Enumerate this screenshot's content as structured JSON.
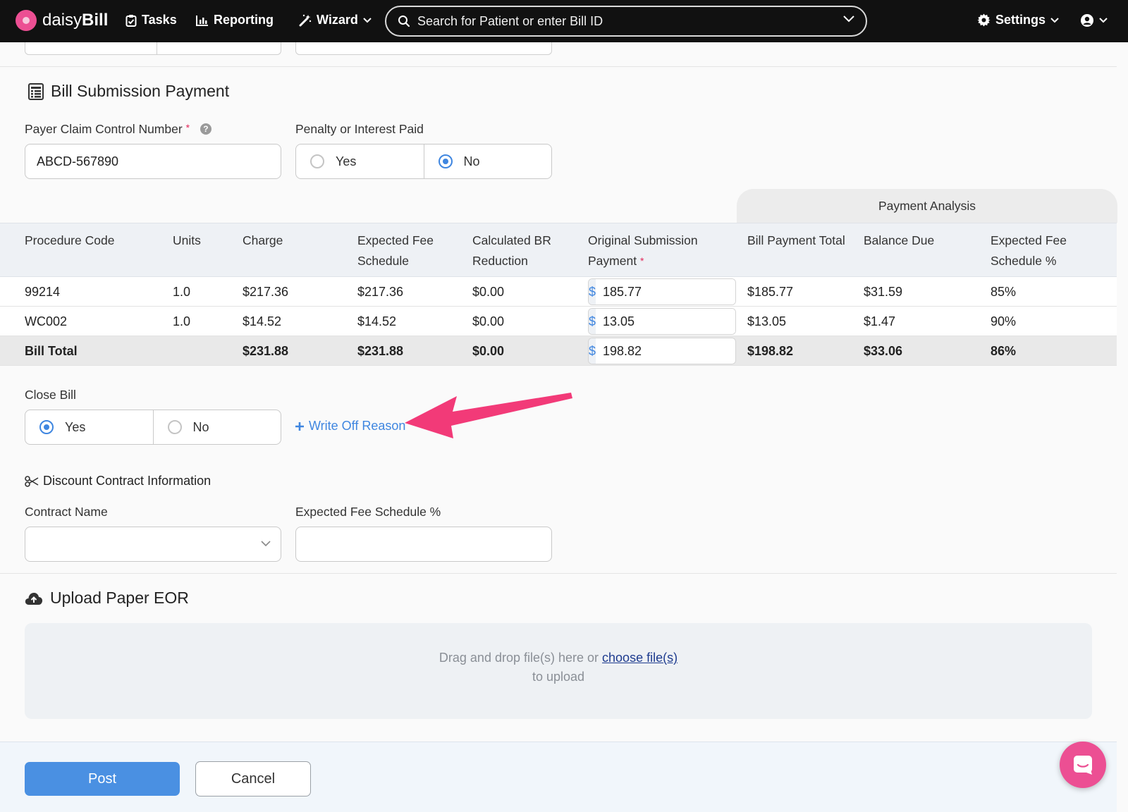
{
  "nav": {
    "brand_prefix": "daisy",
    "brand_suffix": "Bill",
    "tasks": "Tasks",
    "reporting": "Reporting",
    "wizard": "Wizard",
    "search_placeholder": "Search for Patient or enter Bill ID",
    "settings": "Settings"
  },
  "payment_section": {
    "title": "Bill Submission Payment",
    "claim_label": "Payer Claim Control Number",
    "claim_value": "ABCD-567890",
    "penalty_label": "Penalty or Interest Paid",
    "penalty_yes": "Yes",
    "penalty_no": "No",
    "penalty_selected": "No"
  },
  "table": {
    "payment_analysis_label": "Payment Analysis",
    "headers": {
      "procedure_code": "Procedure Code",
      "units": "Units",
      "charge": "Charge",
      "expected_fee_1": "Expected Fee",
      "expected_fee_2": "Schedule",
      "calc_br_1": "Calculated BR",
      "calc_br_2": "Reduction",
      "orig_payment_1": "Original Submission",
      "orig_payment_2": "Payment",
      "bill_payment_total": "Bill Payment Total",
      "balance_due": "Balance Due",
      "expected_pct_1": "Expected Fee",
      "expected_pct_2": "Schedule %"
    },
    "currency_symbol": "$",
    "rows": [
      {
        "code": "99214",
        "units": "1.0",
        "charge": "$217.36",
        "expected_fee": "$217.36",
        "br_reduction": "$0.00",
        "payment": "185.77",
        "bill_payment_total": "$185.77",
        "balance_due": "$31.59",
        "expected_pct": "85%"
      },
      {
        "code": "WC002",
        "units": "1.0",
        "charge": "$14.52",
        "expected_fee": "$14.52",
        "br_reduction": "$0.00",
        "payment": "13.05",
        "bill_payment_total": "$13.05",
        "balance_due": "$1.47",
        "expected_pct": "90%"
      }
    ],
    "total": {
      "label": "Bill Total",
      "charge": "$231.88",
      "expected_fee": "$231.88",
      "br_reduction": "$0.00",
      "payment": "198.82",
      "bill_payment_total": "$198.82",
      "balance_due": "$33.06",
      "expected_pct": "86%"
    }
  },
  "close_bill": {
    "label": "Close Bill",
    "yes": "Yes",
    "no": "No",
    "selected": "Yes",
    "write_off_link": "Write Off Reason"
  },
  "discount": {
    "title": "Discount Contract Information",
    "contract_label": "Contract Name",
    "contract_value": "",
    "fee_pct_label": "Expected Fee Schedule %",
    "fee_pct_value": ""
  },
  "upload": {
    "title": "Upload Paper EOR",
    "drop_text": "Drag and drop file(s) here or",
    "choose_link": "choose file(s)",
    "drop_text_2": "to upload"
  },
  "footer": {
    "post": "Post",
    "cancel": "Cancel"
  },
  "colors": {
    "accent": "#3f86e0",
    "primary_button": "#4a90e2",
    "brand_pink": "#ec4f93",
    "annotation_arrow": "#f23a78"
  }
}
